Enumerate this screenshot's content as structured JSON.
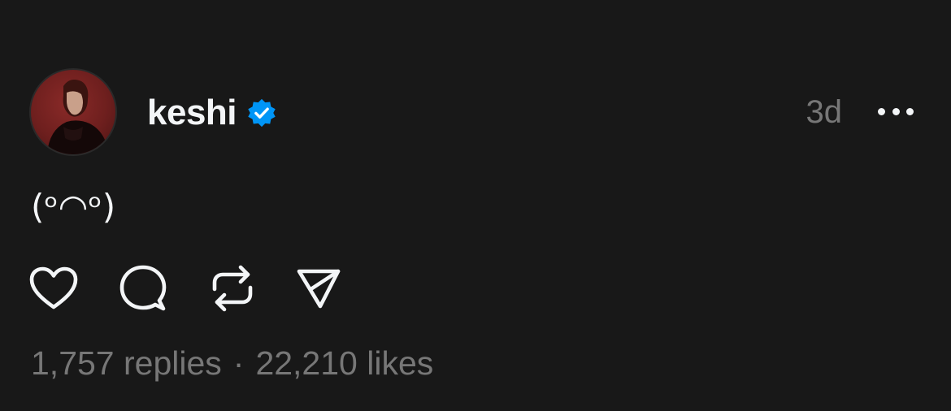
{
  "post": {
    "author": {
      "username": "keshi",
      "verified": true,
      "verified_color": "#0095f6",
      "avatar": "profile-photo"
    },
    "time": "3d",
    "more_icon": "more-horizontal-icon",
    "text": "(ᵒ◠ᵒ)",
    "actions": [
      {
        "name": "like",
        "icon": "heart-icon"
      },
      {
        "name": "reply",
        "icon": "comment-icon"
      },
      {
        "name": "repost",
        "icon": "repost-icon"
      },
      {
        "name": "share",
        "icon": "send-icon"
      }
    ],
    "stats": {
      "replies": "1,757 replies",
      "separator": "·",
      "likes": "22,210 likes"
    }
  },
  "colors": {
    "background": "#181818",
    "primary_text": "#f3f5f7",
    "secondary_text": "#777777"
  }
}
